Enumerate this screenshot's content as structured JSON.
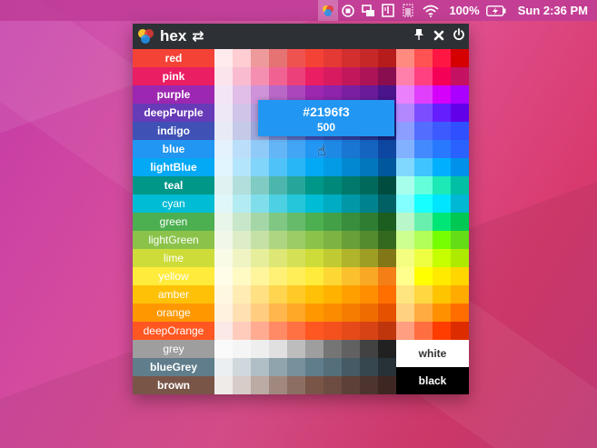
{
  "menubar": {
    "icons": [
      "hex-app-icon",
      "stop-icon",
      "screen-share-icon",
      "book-icon",
      "battery-meter-icon",
      "wifi-icon",
      "battery-icon"
    ],
    "battery_text": "100%",
    "clock": "Sun 2:36 PM"
  },
  "window": {
    "title": "hex",
    "tooltip": {
      "hex": "#2196f3",
      "shade": "500"
    },
    "white_label": "white",
    "black_label": "black",
    "rows": [
      {
        "name": "red",
        "label_color": "#f44336",
        "soft": false,
        "shades": [
          "#ffebee",
          "#ffcdd2",
          "#ef9a9a",
          "#e57373",
          "#ef5350",
          "#f44336",
          "#e53935",
          "#d32f2f",
          "#c62828",
          "#b71c1c"
        ],
        "accents": [
          "#ff8a80",
          "#ff5252",
          "#ff1744",
          "#d50000"
        ]
      },
      {
        "name": "pink",
        "label_color": "#e91e63",
        "soft": false,
        "shades": [
          "#fce4ec",
          "#f8bbd0",
          "#f48fb1",
          "#f06292",
          "#ec407a",
          "#e91e63",
          "#d81b60",
          "#c2185b",
          "#ad1457",
          "#880e4f"
        ],
        "accents": [
          "#ff80ab",
          "#ff4081",
          "#f50057",
          "#c51162"
        ]
      },
      {
        "name": "purple",
        "label_color": "#9c27b0",
        "soft": false,
        "shades": [
          "#f3e5f5",
          "#e1bee7",
          "#ce93d8",
          "#ba68c8",
          "#ab47bc",
          "#9c27b0",
          "#8e24aa",
          "#7b1fa2",
          "#6a1b9a",
          "#4a148c"
        ],
        "accents": [
          "#ea80fc",
          "#e040fb",
          "#d500f9",
          "#aa00ff"
        ]
      },
      {
        "name": "deepPurple",
        "label_color": "#673ab7",
        "soft": false,
        "shades": [
          "#ede7f6",
          "#d1c4e9",
          "#b39ddb",
          "#9575cd",
          "#7e57c2",
          "#673ab7",
          "#5e35b1",
          "#512da8",
          "#4527a0",
          "#311b92"
        ],
        "accents": [
          "#b388ff",
          "#7c4dff",
          "#651fff",
          "#6200ea"
        ]
      },
      {
        "name": "indigo",
        "label_color": "#3f51b5",
        "soft": false,
        "shades": [
          "#e8eaf6",
          "#c5cae9",
          "#9fa8da",
          "#7986cb",
          "#5c6bc0",
          "#3f51b5",
          "#3949ab",
          "#303f9f",
          "#283593",
          "#1a237e"
        ],
        "accents": [
          "#8c9eff",
          "#536dfe",
          "#3d5afe",
          "#304ffe"
        ]
      },
      {
        "name": "blue",
        "label_color": "#2196f3",
        "soft": false,
        "shades": [
          "#e3f2fd",
          "#bbdefb",
          "#90caf9",
          "#64b5f6",
          "#42a5f5",
          "#2196f3",
          "#1e88e5",
          "#1976d2",
          "#1565c0",
          "#0d47a1"
        ],
        "accents": [
          "#82b1ff",
          "#448aff",
          "#2979ff",
          "#2962ff"
        ]
      },
      {
        "name": "lightBlue",
        "label_color": "#03a9f4",
        "soft": false,
        "shades": [
          "#e1f5fe",
          "#b3e5fc",
          "#81d4fa",
          "#4fc3f7",
          "#29b6f6",
          "#03a9f4",
          "#039be5",
          "#0288d1",
          "#0277bd",
          "#01579b"
        ],
        "accents": [
          "#80d8ff",
          "#40c4ff",
          "#00b0ff",
          "#0091ea"
        ]
      },
      {
        "name": "teal",
        "label_color": "#009688",
        "soft": false,
        "shades": [
          "#e0f2f1",
          "#b2dfdb",
          "#80cbc4",
          "#4db6ac",
          "#26a69a",
          "#009688",
          "#00897b",
          "#00796b",
          "#00695c",
          "#004d40"
        ],
        "accents": [
          "#a7ffeb",
          "#64ffda",
          "#1de9b6",
          "#00bfa5"
        ]
      },
      {
        "name": "cyan",
        "label_color": "#00bcd4",
        "soft": true,
        "shades": [
          "#e0f7fa",
          "#b2ebf2",
          "#80deea",
          "#4dd0e1",
          "#26c6da",
          "#00bcd4",
          "#00acc1",
          "#0097a7",
          "#00838f",
          "#006064"
        ],
        "accents": [
          "#84ffff",
          "#18ffff",
          "#00e5ff",
          "#00b8d4"
        ]
      },
      {
        "name": "green",
        "label_color": "#4caf50",
        "soft": true,
        "shades": [
          "#e8f5e9",
          "#c8e6c9",
          "#a5d6a7",
          "#81c784",
          "#66bb6a",
          "#4caf50",
          "#43a047",
          "#388e3c",
          "#2e7d32",
          "#1b5e20"
        ],
        "accents": [
          "#b9f6ca",
          "#69f0ae",
          "#00e676",
          "#00c853"
        ]
      },
      {
        "name": "lightGreen",
        "label_color": "#8bc34a",
        "soft": true,
        "shades": [
          "#f1f8e9",
          "#dcedc8",
          "#c5e1a5",
          "#aed581",
          "#9ccc65",
          "#8bc34a",
          "#7cb342",
          "#689f38",
          "#558b2f",
          "#33691e"
        ],
        "accents": [
          "#ccff90",
          "#b2ff59",
          "#76ff03",
          "#64dd17"
        ]
      },
      {
        "name": "lime",
        "label_color": "#cddc39",
        "soft": true,
        "shades": [
          "#f9fbe7",
          "#f0f4c3",
          "#e6ee9c",
          "#dce775",
          "#d4e157",
          "#cddc39",
          "#c0ca33",
          "#afb42b",
          "#9e9d24",
          "#827717"
        ],
        "accents": [
          "#f4ff81",
          "#eeff41",
          "#c6ff00",
          "#aeea00"
        ]
      },
      {
        "name": "yellow",
        "label_color": "#ffeb3b",
        "soft": true,
        "shades": [
          "#fffde7",
          "#fff9c4",
          "#fff59d",
          "#fff176",
          "#ffee58",
          "#ffeb3b",
          "#fdd835",
          "#fbc02d",
          "#f9a825",
          "#f57f17"
        ],
        "accents": [
          "#ffff8d",
          "#ffff00",
          "#ffea00",
          "#ffd600"
        ]
      },
      {
        "name": "amber",
        "label_color": "#ffc107",
        "soft": true,
        "shades": [
          "#fff8e1",
          "#ffecb3",
          "#ffe082",
          "#ffd54f",
          "#ffca28",
          "#ffc107",
          "#ffb300",
          "#ffa000",
          "#ff8f00",
          "#ff6f00"
        ],
        "accents": [
          "#ffe57f",
          "#ffd740",
          "#ffc400",
          "#ffab00"
        ]
      },
      {
        "name": "orange",
        "label_color": "#ff9800",
        "soft": true,
        "shades": [
          "#fff3e0",
          "#ffe0b2",
          "#ffcc80",
          "#ffb74d",
          "#ffa726",
          "#ff9800",
          "#fb8c00",
          "#f57c00",
          "#ef6c00",
          "#e65100"
        ],
        "accents": [
          "#ffd180",
          "#ffab40",
          "#ff9100",
          "#ff6d00"
        ]
      },
      {
        "name": "deepOrange",
        "label_color": "#ff5722",
        "soft": true,
        "shades": [
          "#fbe9e7",
          "#ffccbc",
          "#ffab91",
          "#ff8a65",
          "#ff7043",
          "#ff5722",
          "#f4511e",
          "#e64a19",
          "#d84315",
          "#bf360c"
        ],
        "accents": [
          "#ff9e80",
          "#ff6e40",
          "#ff3d00",
          "#dd2c00"
        ]
      },
      {
        "name": "grey",
        "label_color": "#9e9e9e",
        "soft": true,
        "shades": [
          "#fafafa",
          "#f5f5f5",
          "#eeeeee",
          "#e0e0e0",
          "#bdbdbd",
          "#9e9e9e",
          "#757575",
          "#616161",
          "#424242",
          "#212121"
        ],
        "accents": []
      },
      {
        "name": "blueGrey",
        "label_color": "#607d8b",
        "soft": false,
        "shades": [
          "#eceff1",
          "#cfd8dc",
          "#b0bec5",
          "#90a4ae",
          "#78909c",
          "#607d8b",
          "#546e7a",
          "#455a64",
          "#37474f",
          "#263238"
        ],
        "accents": []
      },
      {
        "name": "brown",
        "label_color": "#795548",
        "soft": false,
        "shades": [
          "#efebe9",
          "#d7ccc8",
          "#bcaaa4",
          "#a1887f",
          "#8d6e63",
          "#795548",
          "#6d4c41",
          "#5d4037",
          "#4e342e",
          "#3e2723"
        ],
        "accents": []
      }
    ]
  }
}
